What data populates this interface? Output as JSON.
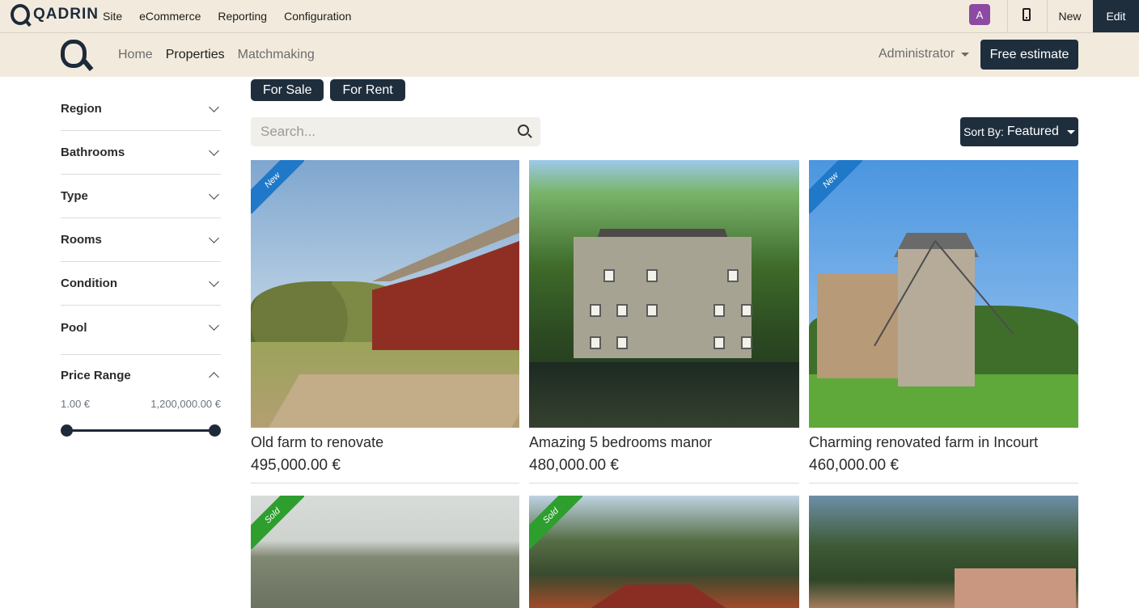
{
  "admin_bar": {
    "brand": "QADRIN",
    "menu": [
      "Site",
      "eCommerce",
      "Reporting",
      "Configuration"
    ],
    "avatar_letter": "A",
    "new_label": "New",
    "edit_label": "Edit"
  },
  "site_header": {
    "nav": [
      "Home",
      "Properties",
      "Matchmaking"
    ],
    "active_nav": "Properties",
    "user_menu": "Administrator",
    "cta": "Free estimate"
  },
  "filters": {
    "items": [
      "Region",
      "Bathrooms",
      "Type",
      "Rooms",
      "Condition",
      "Pool"
    ],
    "price_range": {
      "label": "Price Range",
      "min": "1.00 €",
      "max": "1,200,000.00 €",
      "selected_low_fraction": 0,
      "selected_high_fraction": 1
    }
  },
  "listing_toggle": [
    "For Sale",
    "For Rent"
  ],
  "search": {
    "placeholder": "Search..."
  },
  "sort": {
    "prefix": "Sort By:",
    "value": "Featured"
  },
  "properties": [
    {
      "title": "Old farm to renovate",
      "price": "495,000.00 €",
      "ribbon": "New"
    },
    {
      "title": "Amazing 5 bedrooms manor",
      "price": "480,000.00 €",
      "ribbon": ""
    },
    {
      "title": "Charming renovated farm in Incourt",
      "price": "460,000.00 €",
      "ribbon": "New"
    },
    {
      "title": "",
      "price": "",
      "ribbon": "Sold"
    },
    {
      "title": "",
      "price": "",
      "ribbon": "Sold"
    },
    {
      "title": "",
      "price": "",
      "ribbon": ""
    }
  ],
  "colors": {
    "header_bg": "#f2ebdd",
    "primary_dark": "#1f2e3d",
    "ribbon_new": "#1f78c8",
    "ribbon_sold": "#2e9e2e",
    "avatar_bg": "#8c4aa3"
  }
}
